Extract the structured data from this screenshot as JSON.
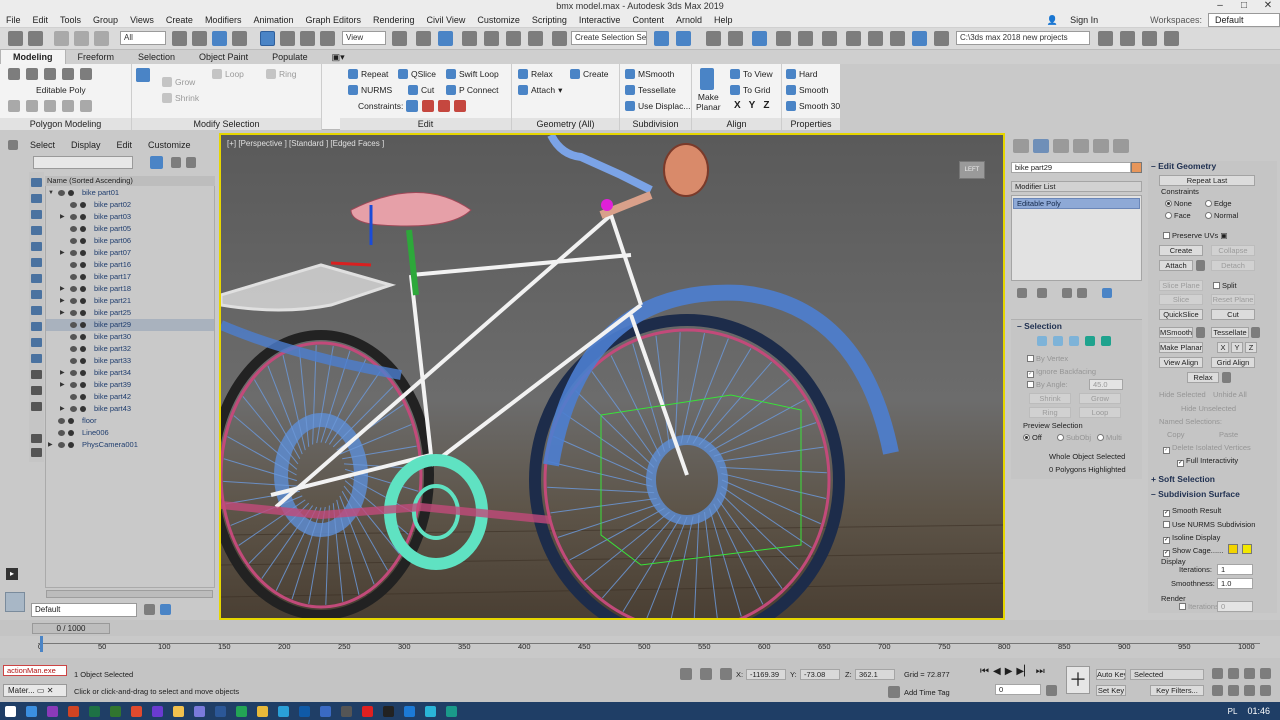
{
  "title": "bmx model.max - Autodesk 3ds Max 2019",
  "window_controls": [
    "–",
    "□",
    "✕"
  ],
  "menu": [
    "File",
    "Edit",
    "Tools",
    "Group",
    "Views",
    "Create",
    "Modifiers",
    "Animation",
    "Graph Editors",
    "Rendering",
    "Civil View",
    "Customize",
    "Scripting",
    "Interactive",
    "Content",
    "Arnold",
    "Help"
  ],
  "account": {
    "sign_in": "Sign In",
    "workspaces_label": "Workspaces:",
    "workspace": "Default"
  },
  "toolbar": {
    "selection_filter": "All",
    "ref_coord": "View",
    "named_sel": "Create Selection Se",
    "project_path": "C:\\3ds max 2018 new projects"
  },
  "ribbon_tabs": [
    "Modeling",
    "Freeform",
    "Selection",
    "Object Paint",
    "Populate"
  ],
  "ribbon": {
    "poly": {
      "mode": "Editable Poly",
      "footer": "Polygon Modeling"
    },
    "modify_sel": {
      "grow": "Grow",
      "shrink": "Shrink",
      "loop": "Loop",
      "ring": "Ring",
      "footer": "Modify Selection"
    },
    "edit": {
      "repeat": "Repeat",
      "qslice": "QSlice",
      "swift_loop": "Swift Loop",
      "nurms": "NURMS",
      "cut": "Cut",
      "p_connect": "P Connect",
      "constraints": "Constraints:",
      "footer": "Edit"
    },
    "geometry": {
      "relax": "Relax",
      "create": "Create",
      "attach": "Attach",
      "footer": "Geometry (All)"
    },
    "subdivision": {
      "msmooth": "MSmooth",
      "tessellate": "Tessellate",
      "use_displace": "Use Displac...",
      "footer": "Subdivision"
    },
    "align": {
      "make_planar_1": "Make",
      "make_planar_2": "Planar",
      "to_view": "To View",
      "to_grid": "To Grid",
      "x": "X",
      "y": "Y",
      "z": "Z",
      "footer": "Align"
    },
    "properties": {
      "hard": "Hard",
      "smooth": "Smooth",
      "smooth30": "Smooth 30",
      "footer": "Properties"
    }
  },
  "explorer": {
    "menu": [
      "Select",
      "Display",
      "Edit",
      "Customize"
    ],
    "column_header": "Name (Sorted Ascending)",
    "items": [
      {
        "name": "bike part01",
        "level": 0,
        "expand": "▼"
      },
      {
        "name": "bike part02",
        "level": 1,
        "expand": ""
      },
      {
        "name": "bike part03",
        "level": 1,
        "expand": "▶"
      },
      {
        "name": "bike part05",
        "level": 1,
        "expand": ""
      },
      {
        "name": "bike part06",
        "level": 1,
        "expand": ""
      },
      {
        "name": "bike part07",
        "level": 1,
        "expand": "▶"
      },
      {
        "name": "bike part16",
        "level": 1,
        "expand": ""
      },
      {
        "name": "bike part17",
        "level": 1,
        "expand": ""
      },
      {
        "name": "bike part18",
        "level": 1,
        "expand": "▶"
      },
      {
        "name": "bike part21",
        "level": 1,
        "expand": "▶"
      },
      {
        "name": "bike part25",
        "level": 1,
        "expand": "▶"
      },
      {
        "name": "bike part29",
        "level": 1,
        "expand": "",
        "selected": true
      },
      {
        "name": "bike part30",
        "level": 1,
        "expand": ""
      },
      {
        "name": "bike part32",
        "level": 1,
        "expand": ""
      },
      {
        "name": "bike part33",
        "level": 1,
        "expand": ""
      },
      {
        "name": "bike part34",
        "level": 1,
        "expand": "▶"
      },
      {
        "name": "bike part39",
        "level": 1,
        "expand": "▶"
      },
      {
        "name": "bike part42",
        "level": 1,
        "expand": ""
      },
      {
        "name": "bike part43",
        "level": 1,
        "expand": "▶"
      },
      {
        "name": "floor",
        "level": 0,
        "expand": ""
      },
      {
        "name": "Line006",
        "level": 0,
        "expand": ""
      },
      {
        "name": "PhysCamera001",
        "level": 0,
        "expand": "▶"
      }
    ],
    "layer": "Default"
  },
  "viewport": {
    "label": "[+] [Perspective ] [Standard ] [Edged Faces ]",
    "viewcube": "LEFT"
  },
  "command_panel": {
    "object_name": "bike part29",
    "object_color": "#e8965a",
    "modifier_list": "Modifier List",
    "stack_item": "Editable Poly",
    "selection": {
      "title": "Selection",
      "by_vertex": "By Vertex",
      "ignore_backfacing": "Ignore Backfacing",
      "by_angle": "By Angle:",
      "by_angle_value": "45.0",
      "shrink": "Shrink",
      "grow": "Grow",
      "ring": "Ring",
      "loop": "Loop",
      "preview_selection": "Preview Selection",
      "off": "Off",
      "subobj": "SubObj",
      "multi": "Multi",
      "status1": "Whole Object Selected",
      "status2": "0 Polygons Highlighted"
    },
    "edit_geometry": {
      "title": "Edit Geometry",
      "repeat_last": "Repeat Last",
      "constraints": "Constraints",
      "none": "None",
      "edge": "Edge",
      "face": "Face",
      "normal": "Normal",
      "preserve_uvs": "Preserve UVs",
      "create": "Create",
      "collapse": "Collapse",
      "attach": "Attach",
      "detach": "Detach",
      "slice_plane": "Slice Plane",
      "split": "Split",
      "slice": "Slice",
      "reset_plane": "Reset Plane",
      "quickslice": "QuickSlice",
      "cut": "Cut",
      "msmooth": "MSmooth",
      "tessellate": "Tessellate",
      "make_planar": "Make Planar",
      "x": "X",
      "y": "Y",
      "z": "Z",
      "view_align": "View Align",
      "grid_align": "Grid Align",
      "relax": "Relax",
      "hide_selected": "Hide Selected",
      "unhide_all": "Unhide All",
      "hide_unselected": "Hide Unselected",
      "named_selections": "Named Selections:",
      "copy": "Copy",
      "paste": "Paste",
      "delete_isolated": "Delete Isolated Vertices",
      "full_interactivity": "Full Interactivity"
    },
    "soft_selection": {
      "title": "Soft Selection"
    },
    "subdivision_surface": {
      "title": "Subdivision Surface",
      "smooth_result": "Smooth Result",
      "use_nurms": "Use NURMS Subdivision",
      "isoline_display": "Isoline Display",
      "show_cage": "Show Cage......",
      "display": "Display",
      "iterations_label": "Iterations:",
      "iterations": "1",
      "smoothness_label": "Smoothness:",
      "smoothness": "1.0",
      "render": "Render",
      "render_iterations_label": "Iterations:",
      "render_iterations": "0"
    }
  },
  "timeline": {
    "frame": "0 / 1000",
    "ticks": [
      "0",
      "50",
      "100",
      "150",
      "200",
      "250",
      "300",
      "350",
      "400",
      "450",
      "500",
      "550",
      "600",
      "650",
      "700",
      "750",
      "800",
      "850",
      "900",
      "950",
      "1000"
    ]
  },
  "status": {
    "maxscript": "actionMan.exe",
    "objects_selected": "1 Object Selected",
    "prompt": "Click or click-and-drag to select and move objects",
    "material_btn": "Mater...",
    "x_label": "X:",
    "x": "-1169.39",
    "y_label": "Y:",
    "y": "-73.08",
    "z_label": "Z:",
    "z": "362.1",
    "grid": "Grid = 72.877",
    "add_time_tag": "Add Time Tag",
    "auto_key": "Auto Key",
    "set_key": "Set Key",
    "selected": "Selected",
    "key_filters": "Key Filters...",
    "frame_field": "0"
  },
  "taskbar": {
    "lang": "PL",
    "clock": "01:46"
  }
}
